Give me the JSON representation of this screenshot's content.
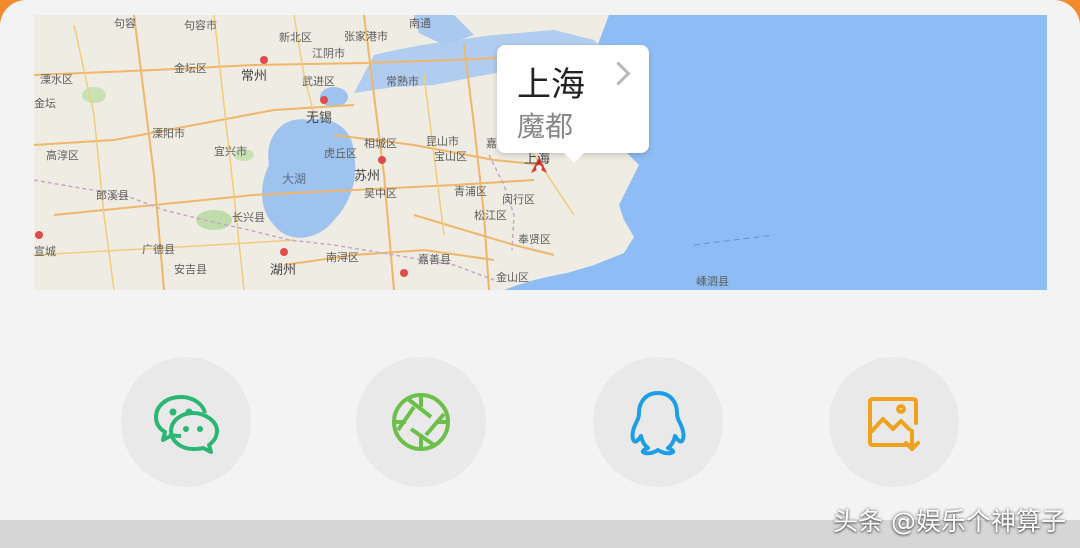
{
  "map": {
    "callout": {
      "title": "上海",
      "subtitle": "魔都"
    },
    "labels": {
      "jurong": "句容",
      "jintan": "金坛区",
      "changzhou": "常州",
      "wujin": "武进区",
      "zhangjiagang": "张家港市",
      "changshu": "常熟市",
      "liyang": "溧阳市",
      "wuxi": "无锡",
      "yixing": "宜兴市",
      "xiangcheng": "相城区",
      "kunshan": "昆山市",
      "huqiu": "虎丘区",
      "suzhou": "苏州",
      "wuzhong": "吴中区",
      "qingpu": "青浦区",
      "songjiang": "松江区",
      "minhang": "闵行区",
      "shanghai": "上海",
      "gaochun": "高淳区",
      "langxi": "郎溪县",
      "changxing": "长兴县",
      "huzhou": "湖州",
      "guangde": "广德县",
      "nanxun": "南浔区",
      "jiashan": "嘉善县",
      "jiading": "嘉定区",
      "baoshan": "宝山区",
      "fengxian": "奉贤区",
      "jinshan": "金山区",
      "shengsi": "嵊泗县",
      "taihu": "大湖",
      "yixi": "宣城",
      "nantong": "南通",
      "jinhu": "金坛",
      "jiangyin": "江阴市",
      "lishui": "溧水区",
      "xinbei": "新北区",
      "zhenjiang": "句容市",
      "anji": "安吉县"
    }
  },
  "share": [
    {
      "name": "wechat",
      "icon": "wechat-icon",
      "color": "#2bb673"
    },
    {
      "name": "moments",
      "icon": "moments-aperture-icon",
      "color": "#6cc04a"
    },
    {
      "name": "qq",
      "icon": "qq-icon",
      "color": "#1e9ee6"
    },
    {
      "name": "save-image",
      "icon": "save-image-icon",
      "color": "#f0a21c"
    }
  ],
  "watermark": "头条 @娱乐个神算子",
  "colors": {
    "accent": "#f08a2a",
    "sea": "#8ebdf5",
    "lake": "#9fc3ef"
  }
}
